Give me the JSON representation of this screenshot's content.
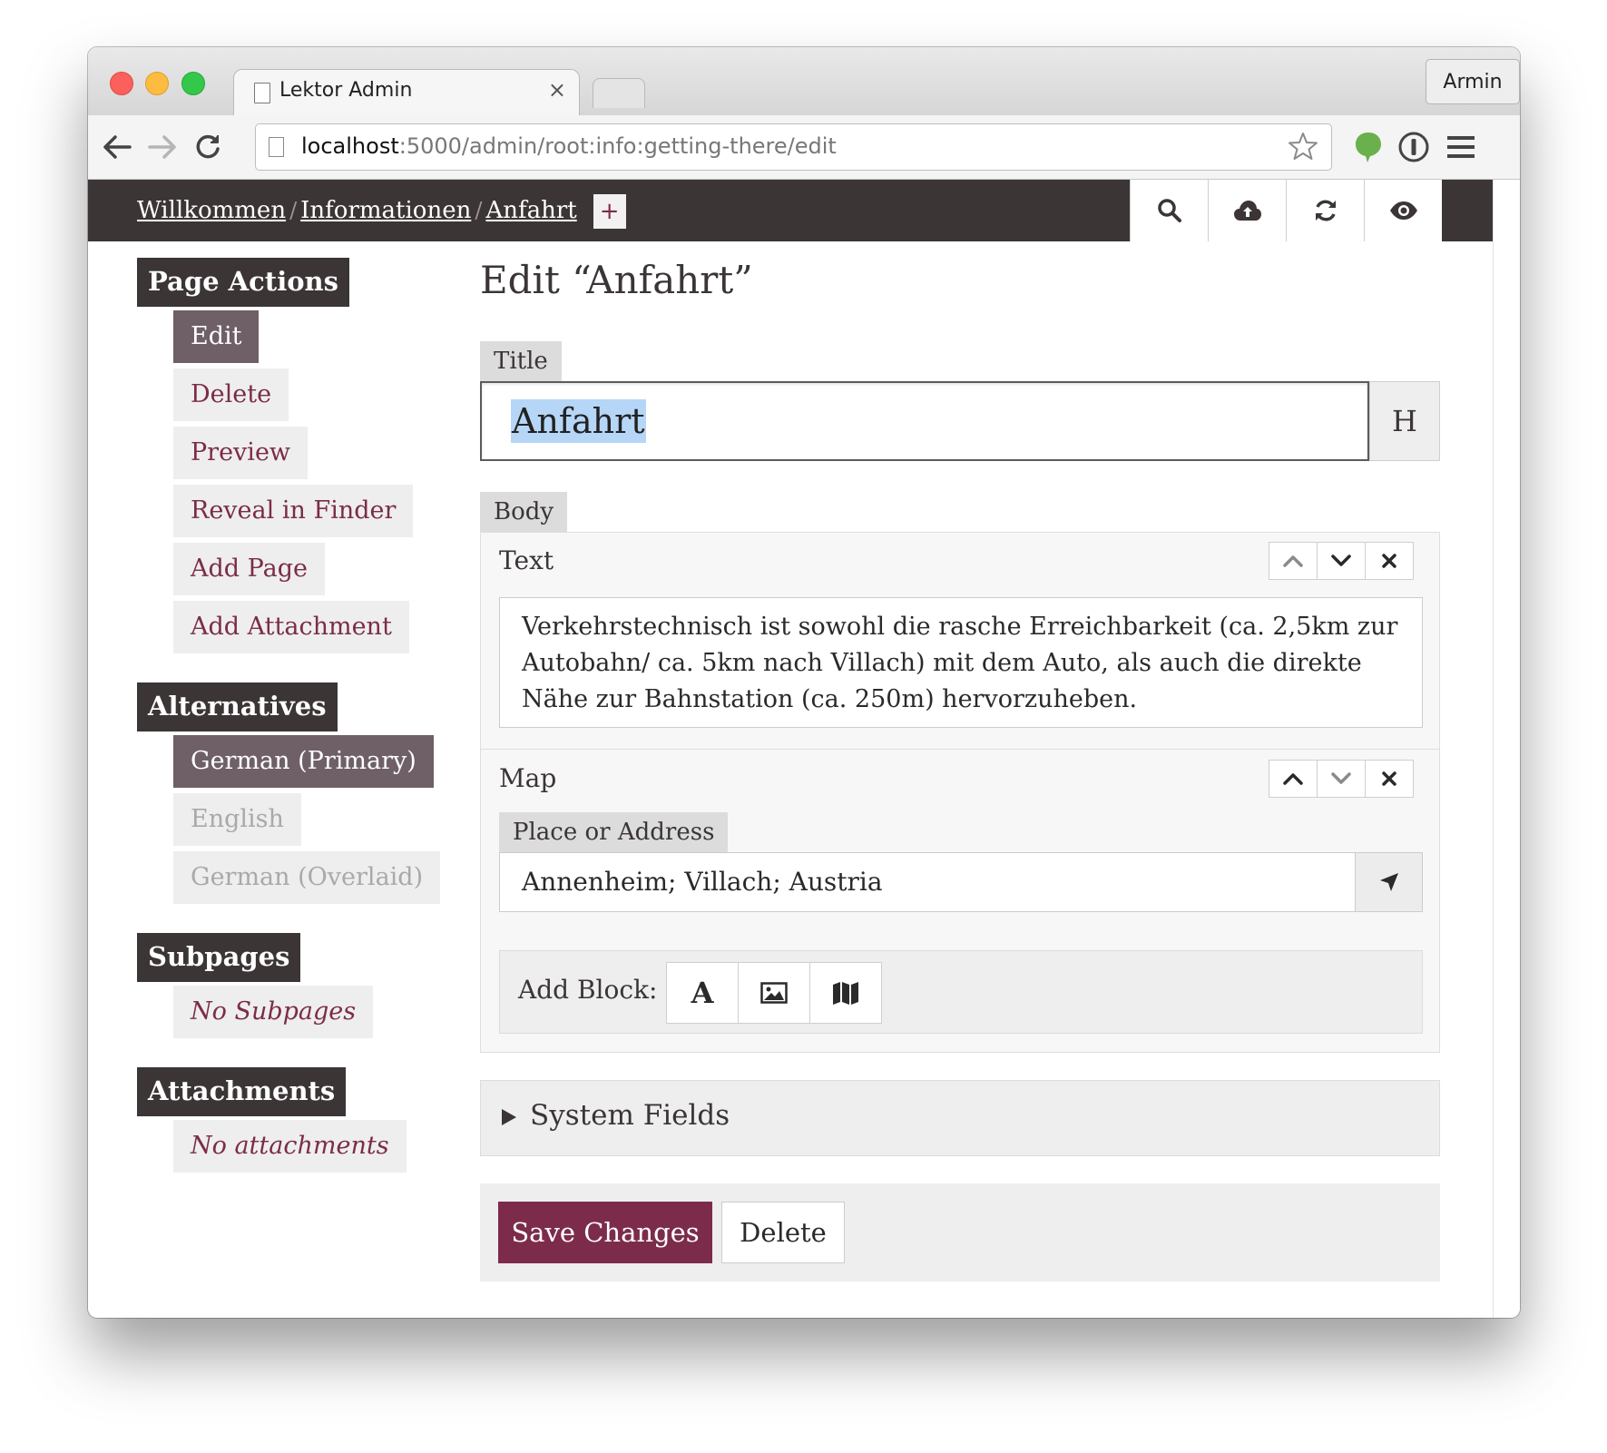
{
  "browser": {
    "tab_title": "Lektor Admin",
    "tab_close": "×",
    "profile_name": "Armin",
    "url_host": "localhost",
    "url_path": ":5000/admin/root:info:getting-there/edit"
  },
  "header": {
    "breadcrumbs": [
      "Willkommen",
      "Informationen",
      "Anfahrt"
    ],
    "separator": "/",
    "add_label": "+",
    "buttons": [
      "search-icon",
      "cloud-upload-icon",
      "refresh-icon",
      "eye-icon"
    ]
  },
  "sidebar": {
    "page_actions": {
      "heading": "Page Actions",
      "items": [
        "Edit",
        "Delete",
        "Preview",
        "Reveal in Finder",
        "Add Page",
        "Add Attachment"
      ],
      "active": "Edit"
    },
    "alternatives": {
      "heading": "Alternatives",
      "items": [
        "German (Primary)",
        "English",
        "German (Overlaid)"
      ],
      "active": "German (Primary)"
    },
    "subpages": {
      "heading": "Subpages",
      "empty_text": "No Subpages"
    },
    "attachments": {
      "heading": "Attachments",
      "empty_text": "No attachments"
    }
  },
  "main": {
    "heading": "Edit “Anfahrt”",
    "title_field": {
      "label": "Title",
      "value": "Anfahrt",
      "heading_button": "H"
    },
    "body_field": {
      "label": "Body",
      "text_block": {
        "title": "Text",
        "content": "Verkehrstechnisch ist sowohl die rasche Erreichbarkeit (ca. 2,5km zur Autobahn/ ca. 5km nach Villach) mit dem Auto, als auch die direkte Nähe zur Bahnstation (ca. 250m) hervorzuheben."
      },
      "map_block": {
        "title": "Map",
        "place_label": "Place or Address",
        "place_value": "Annenheim; Villach; Austria"
      },
      "add_block": {
        "label": "Add Block:",
        "text_button": "A",
        "buttons": [
          "text-block-icon",
          "image-block-icon",
          "map-block-icon"
        ]
      }
    },
    "system_fields": {
      "label": "System Fields"
    },
    "actions": {
      "save": "Save Changes",
      "delete": "Delete"
    }
  },
  "colors": {
    "brand": "#7c2c4a",
    "dark": "#3b3536",
    "active_item": "#6e6066",
    "selection": "#b6d6f7"
  }
}
